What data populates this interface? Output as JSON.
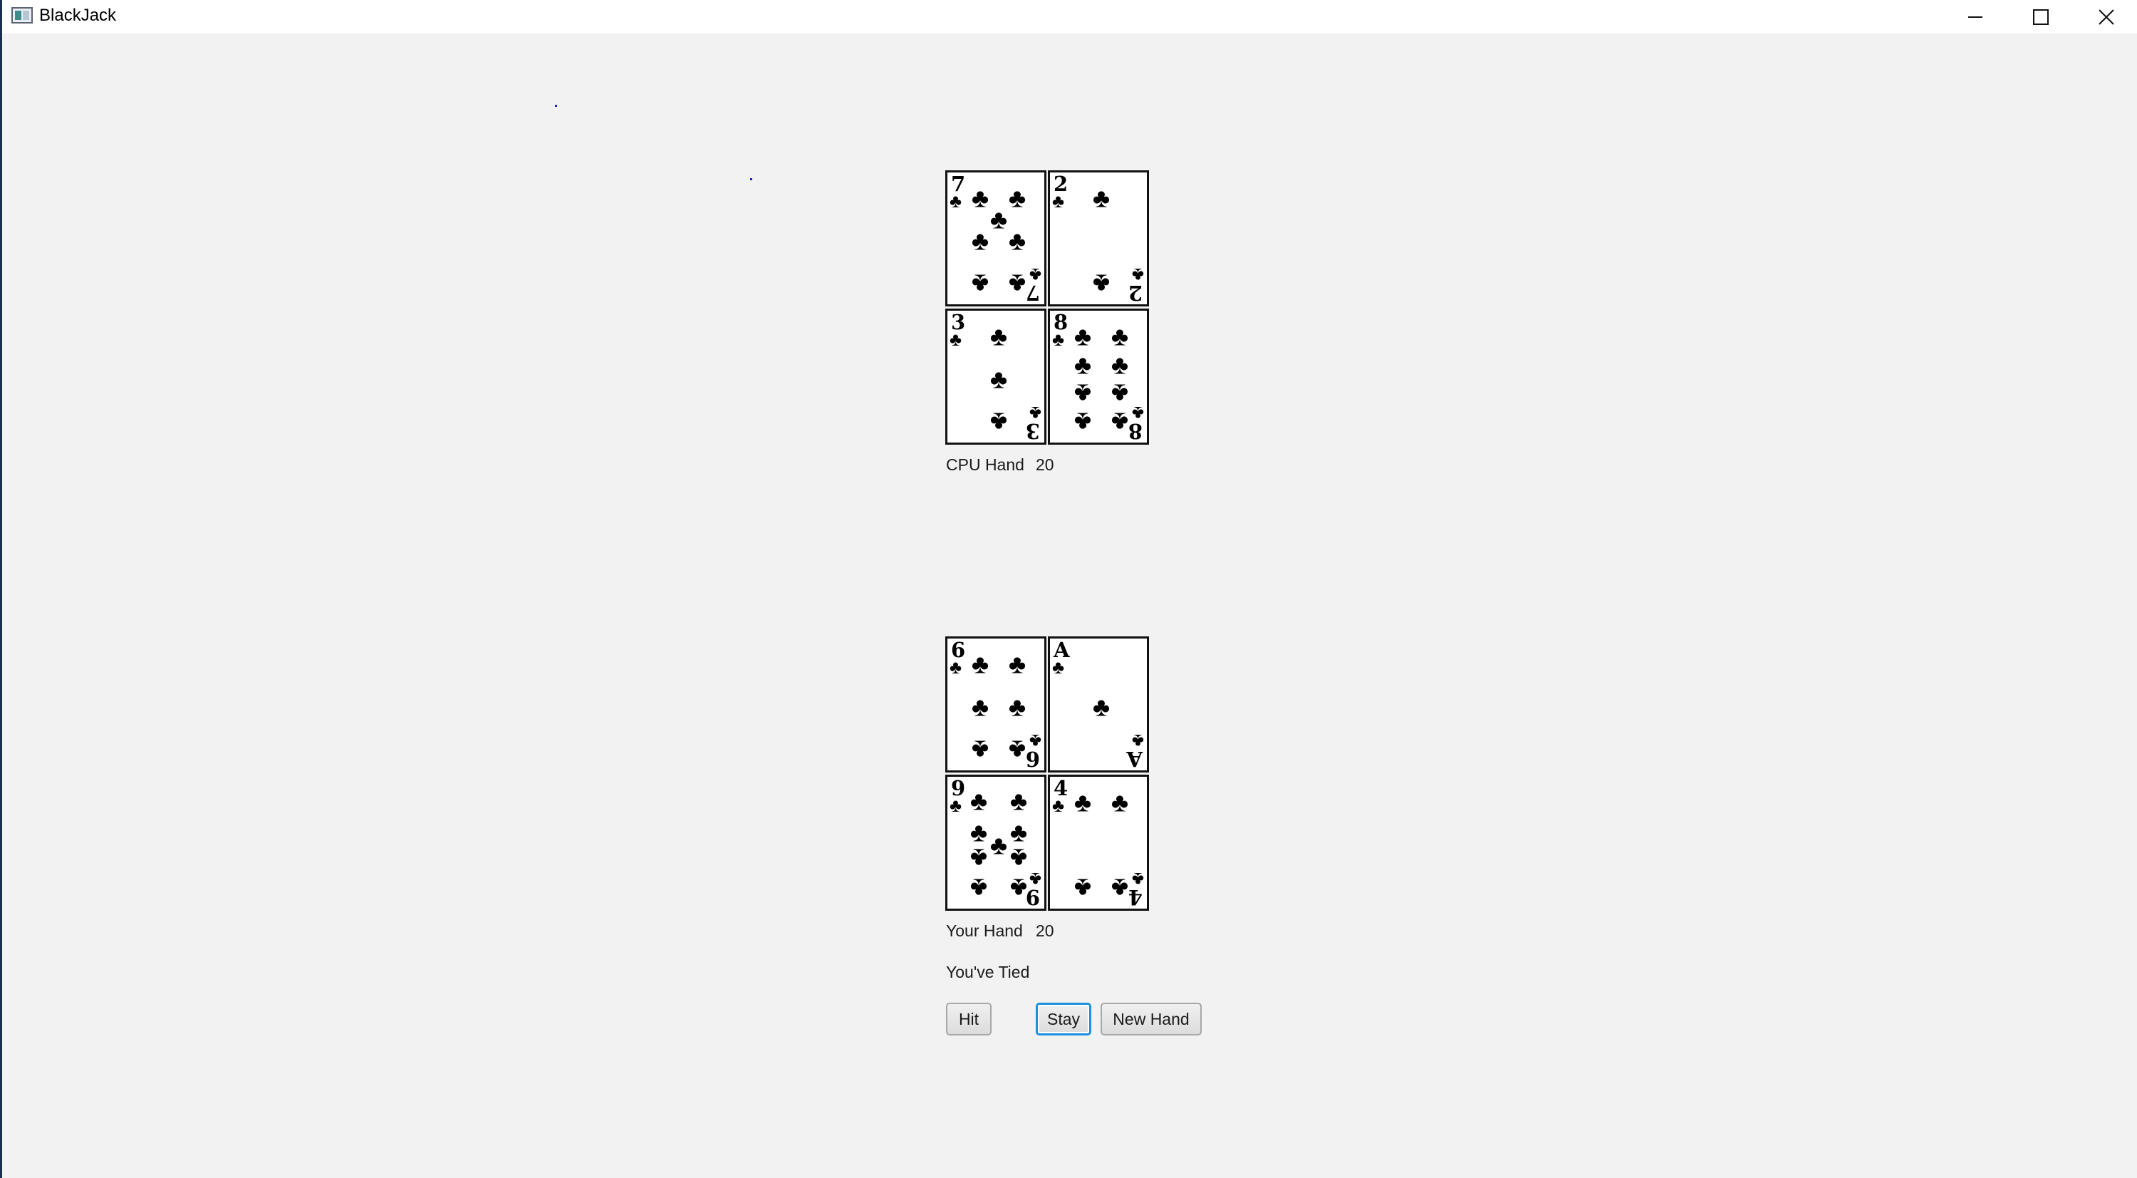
{
  "window": {
    "title": "BlackJack",
    "controls": {
      "minimize": "minimize-icon",
      "maximize": "maximize-icon",
      "close": "close-icon"
    }
  },
  "colors": {
    "background": "#f2f2f2",
    "card_border": "#111111",
    "focus": "#1e90e0"
  },
  "cpu": {
    "label": "CPU Hand",
    "score": "20",
    "cards": [
      {
        "rank": "7",
        "suit": "♣"
      },
      {
        "rank": "2",
        "suit": "♣"
      },
      {
        "rank": "3",
        "suit": "♣"
      },
      {
        "rank": "8",
        "suit": "♣"
      }
    ]
  },
  "player": {
    "label": "Your Hand",
    "score": "20",
    "cards": [
      {
        "rank": "6",
        "suit": "♣"
      },
      {
        "rank": "A",
        "suit": "♣"
      },
      {
        "rank": "9",
        "suit": "♣"
      },
      {
        "rank": "4",
        "suit": "♣"
      }
    ]
  },
  "result": "You've Tied",
  "buttons": {
    "hit": "Hit",
    "stay": "Stay",
    "new_hand": "New Hand"
  }
}
